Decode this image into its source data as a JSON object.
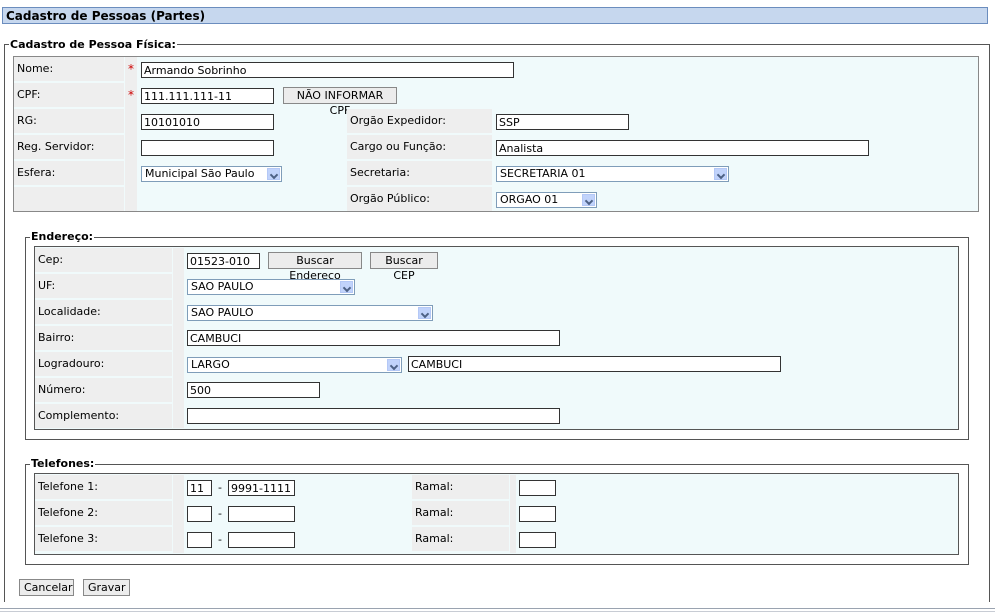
{
  "page_title": "Cadastro de Pessoas (Partes)",
  "pf": {
    "legend": "Cadastro de Pessoa Física:",
    "nome_label": "Nome:",
    "nome_value": "Armando Sobrinho",
    "cpf_label": "CPF:",
    "cpf_value": "111.111.111-11",
    "nao_informar_cpf": "NÃO INFORMAR CPF",
    "required_mark": "*",
    "rg_label": "RG:",
    "rg_value": "10101010",
    "orgao_expedidor_label": "Orgão Expedidor:",
    "orgao_expedidor_value": "SSP",
    "reg_servidor_label": "Reg. Servidor:",
    "reg_servidor_value": "",
    "cargo_label": "Cargo ou Função:",
    "cargo_value": "Analista",
    "esfera_label": "Esfera:",
    "esfera_value": "Municipal São Paulo",
    "secretaria_label": "Secretaria:",
    "secretaria_value": "SECRETARIA 01",
    "orgao_publico_label": "Orgão Público:",
    "orgao_publico_value": "ORGAO 01"
  },
  "endereco": {
    "legend": "Endereço:",
    "cep_label": "Cep:",
    "cep_value": "01523-010",
    "buscar_endereco": "Buscar Endereço",
    "buscar_cep": "Buscar CEP",
    "uf_label": "UF:",
    "uf_value": "SAO PAULO",
    "localidade_label": "Localidade:",
    "localidade_value": "SAO PAULO",
    "bairro_label": "Bairro:",
    "bairro_value": "CAMBUCI",
    "logradouro_label": "Logradouro:",
    "logradouro_tipo": "LARGO",
    "logradouro_value": "CAMBUCI",
    "numero_label": "Número:",
    "numero_value": "500",
    "complemento_label": "Complemento:",
    "complemento_value": ""
  },
  "telefones": {
    "legend": "Telefones:",
    "dash": "-",
    "rows": [
      {
        "label": "Telefone 1:",
        "ddd": "11",
        "numero": "9991-1111",
        "ramal_label": "Ramal:",
        "ramal": ""
      },
      {
        "label": "Telefone 2:",
        "ddd": "",
        "numero": "",
        "ramal_label": "Ramal:",
        "ramal": ""
      },
      {
        "label": "Telefone 3:",
        "ddd": "",
        "numero": "",
        "ramal_label": "Ramal:",
        "ramal": ""
      }
    ]
  },
  "actions": {
    "cancelar": "Cancelar",
    "gravar": "Gravar"
  }
}
